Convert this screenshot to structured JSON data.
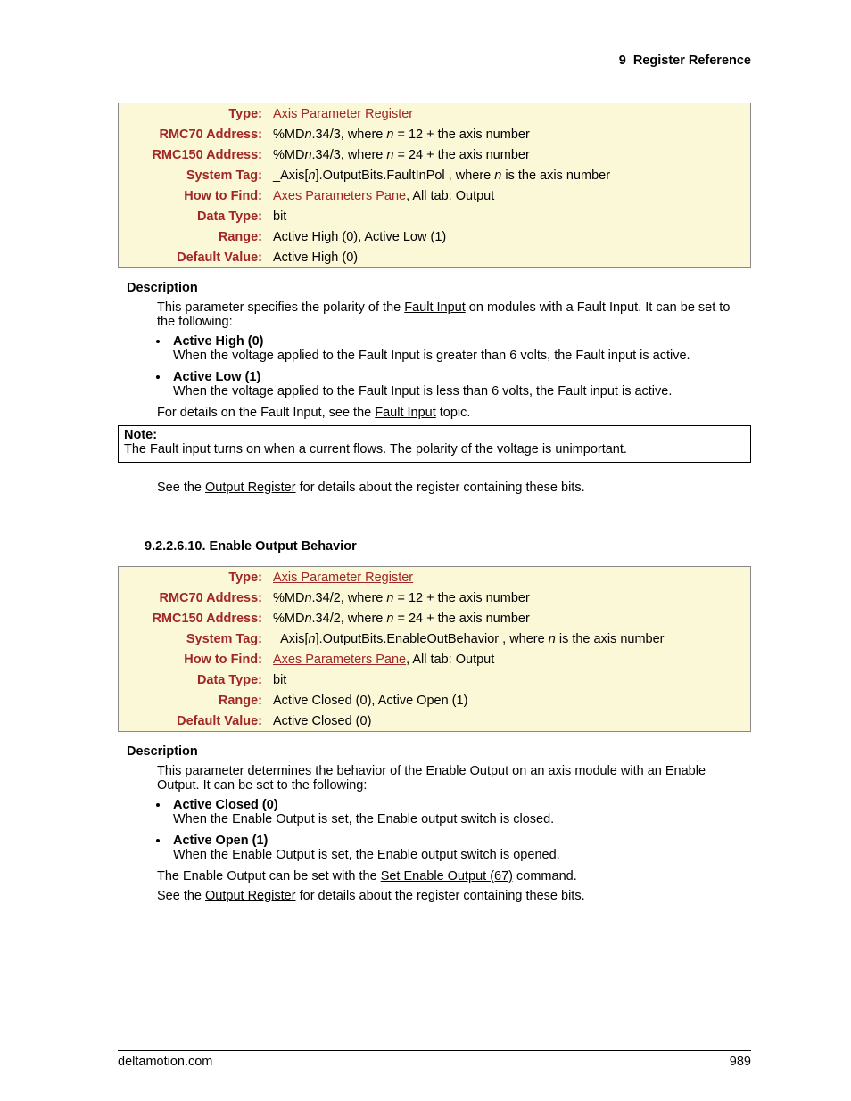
{
  "header": {
    "chapter": "9",
    "title": "Register Reference"
  },
  "table1": {
    "rows": [
      {
        "k": "Type:",
        "v_link": "Axis Parameter Register"
      },
      {
        "k": "RMC70 Address:",
        "v_pre": "%MD",
        "v_it1": "n",
        "v_mid": ".34/3, where ",
        "v_it2": "n",
        "v_post": " = 12 + the axis number"
      },
      {
        "k": "RMC150 Address:",
        "v_pre": "%MD",
        "v_it1": "n",
        "v_mid": ".34/3, where ",
        "v_it2": "n",
        "v_post": " = 24 + the axis number"
      },
      {
        "k": "System Tag:",
        "v_pre": "_Axis[",
        "v_it1": "n",
        "v_mid": "].OutputBits.FaultInPol , where ",
        "v_it2": "n",
        "v_post": " is the axis number"
      },
      {
        "k": "How to Find:",
        "v_link": "Axes Parameters Pane",
        "v_post": ", All tab: Output"
      },
      {
        "k": "Data Type:",
        "v_plain": "bit"
      },
      {
        "k": "Range:",
        "v_plain": "Active High (0), Active Low (1)"
      },
      {
        "k": "Default Value:",
        "v_plain": "Active High (0)"
      }
    ]
  },
  "desc1": {
    "heading": "Description",
    "intro_pre": "This parameter specifies the polarity of the ",
    "intro_link": "Fault Input",
    "intro_post": " on modules with a Fault Input. It can be set to the following:",
    "items": [
      {
        "head": "Active High (0)",
        "body": "When the voltage applied to the Fault Input is greater than 6 volts, the Fault input is active."
      },
      {
        "head": "Active Low (1)",
        "body": "When the voltage applied to the Fault Input is less than 6 volts, the Fault input is active."
      }
    ],
    "tail_pre": "For details on the Fault Input, see the ",
    "tail_link": "Fault Input",
    "tail_post": " topic."
  },
  "note1": {
    "head": "Note:",
    "body": "The Fault input turns on when a current flows. The polarity of the voltage is unimportant."
  },
  "seealso1": {
    "pre": "See the ",
    "link": "Output Register",
    "post": " for details about the register containing these bits."
  },
  "subheading": "9.2.2.6.10. Enable Output Behavior",
  "table2": {
    "rows": [
      {
        "k": "Type:",
        "v_link": "Axis Parameter Register"
      },
      {
        "k": "RMC70 Address:",
        "v_pre": "%MD",
        "v_it1": "n",
        "v_mid": ".34/2, where ",
        "v_it2": "n",
        "v_post": " = 12 + the axis number"
      },
      {
        "k": "RMC150 Address:",
        "v_pre": "%MD",
        "v_it1": "n",
        "v_mid": ".34/2, where ",
        "v_it2": "n",
        "v_post": " = 24 + the axis number"
      },
      {
        "k": "System Tag:",
        "v_pre": "_Axis[",
        "v_it1": "n",
        "v_mid": "].OutputBits.EnableOutBehavior , where ",
        "v_it2": "n",
        "v_post": " is the axis number"
      },
      {
        "k": "How to Find:",
        "v_link": "Axes Parameters Pane",
        "v_post": ", All tab: Output"
      },
      {
        "k": "Data Type:",
        "v_plain": "bit"
      },
      {
        "k": "Range:",
        "v_plain": "Active Closed (0), Active Open (1)"
      },
      {
        "k": "Default Value:",
        "v_plain": "Active Closed (0)"
      }
    ]
  },
  "desc2": {
    "heading": "Description",
    "intro_pre": "This parameter determines the behavior of the ",
    "intro_link": "Enable Output",
    "intro_post": " on an axis module with an Enable Output. It can be set to the following:",
    "items": [
      {
        "head": "Active Closed (0)",
        "body": "When the Enable Output is set, the Enable output switch is closed."
      },
      {
        "head": "Active Open (1)",
        "body": "When the Enable Output is set, the Enable output switch is opened."
      }
    ],
    "line1_pre": "The Enable Output can be set with the ",
    "line1_link": "Set Enable Output (67)",
    "line1_post": " command.",
    "line2_pre": "See the ",
    "line2_link": "Output Register",
    "line2_post": " for details about the register containing these bits."
  },
  "footer": {
    "site": "deltamotion.com",
    "page": "989"
  }
}
